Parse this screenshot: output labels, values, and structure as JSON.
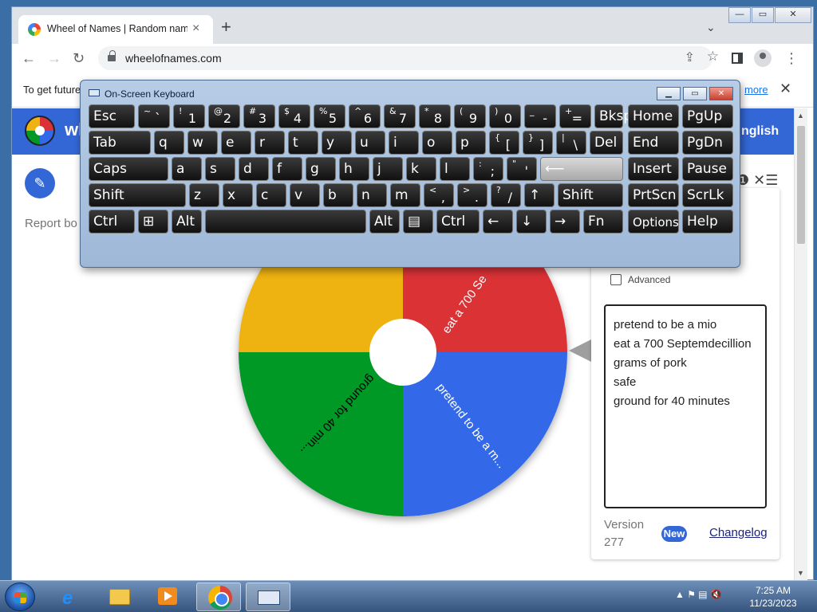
{
  "browser": {
    "tab_title": "Wheel of Names | Random name",
    "tab_close": "×",
    "new_tab": "+",
    "tab_menu": "⌄",
    "url": "wheelofnames.com",
    "back": "←",
    "forward": "→",
    "reload": "↻",
    "share": "⇪",
    "star": "☆",
    "menu": "⋮",
    "win_min": "—",
    "win_max": "▭",
    "win_close": "✕"
  },
  "infobar": {
    "text": "To get future",
    "link": "more",
    "close": "✕"
  },
  "app": {
    "title": "wh",
    "language": "nglish",
    "edit_icon": "✎",
    "report": "Report bo",
    "side_icons": "❶ ✕☰"
  },
  "wheel": {
    "slices": [
      {
        "label": "eat a 700 Se",
        "color": "#db3236"
      },
      {
        "label": "pretend to be a m...",
        "color": "#3369e8"
      },
      {
        "label": "ground for 40 min...",
        "color": "#009925"
      },
      {
        "label": "",
        "color": "#eeb211"
      }
    ]
  },
  "card": {
    "advanced_label": "Advanced",
    "names": [
      "pretend to be a mio",
      "eat a 700 Septemdecillion",
      "grams of pork",
      "safe",
      "ground for 40 minutes"
    ],
    "version_label": "Version",
    "version_number": "277",
    "new_badge": "New",
    "changelog": "Changelog"
  },
  "osk": {
    "title": "On-Screen Keyboard",
    "min": "▁",
    "max": "▭",
    "close": "✕",
    "rows": [
      [
        {
          "main": "Esc"
        },
        {
          "sym": "~",
          "chr": "`"
        },
        {
          "sym": "!",
          "chr": "1"
        },
        {
          "sym": "@",
          "chr": "2"
        },
        {
          "sym": "#",
          "chr": "3"
        },
        {
          "sym": "$",
          "chr": "4"
        },
        {
          "sym": "%",
          "chr": "5"
        },
        {
          "sym": "^",
          "chr": "6"
        },
        {
          "sym": "&",
          "chr": "7"
        },
        {
          "sym": "*",
          "chr": "8"
        },
        {
          "sym": "(",
          "chr": "9"
        },
        {
          "sym": ")",
          "chr": "0"
        },
        {
          "sym": "_",
          "chr": "-"
        },
        {
          "sym": "+",
          "chr": "="
        },
        {
          "main": "Bksp"
        },
        {
          "main": "Home"
        },
        {
          "main": "PgUp"
        }
      ],
      [
        {
          "main": "Tab"
        },
        {
          "main": "q"
        },
        {
          "main": "w"
        },
        {
          "main": "e"
        },
        {
          "main": "r"
        },
        {
          "main": "t"
        },
        {
          "main": "y"
        },
        {
          "main": "u"
        },
        {
          "main": "i"
        },
        {
          "main": "o"
        },
        {
          "main": "p"
        },
        {
          "sym": "{",
          "chr": "["
        },
        {
          "sym": "}",
          "chr": "]"
        },
        {
          "sym": "|",
          "chr": "\\"
        },
        {
          "main": "Del"
        },
        {
          "main": "End"
        },
        {
          "main": "PgDn"
        }
      ],
      [
        {
          "main": "Caps"
        },
        {
          "main": "a"
        },
        {
          "main": "s"
        },
        {
          "main": "d"
        },
        {
          "main": "f"
        },
        {
          "main": "g"
        },
        {
          "main": "h"
        },
        {
          "main": "j"
        },
        {
          "main": "k"
        },
        {
          "main": "l"
        },
        {
          "sym": ":",
          "chr": ";"
        },
        {
          "sym": "\"",
          "chr": "'"
        },
        {
          "main": "⟵"
        },
        {
          "main": "Insert"
        },
        {
          "main": "Pause"
        }
      ],
      [
        {
          "main": "Shift"
        },
        {
          "main": "z"
        },
        {
          "main": "x"
        },
        {
          "main": "c"
        },
        {
          "main": "v"
        },
        {
          "main": "b"
        },
        {
          "main": "n"
        },
        {
          "main": "m"
        },
        {
          "sym": "<",
          "chr": ","
        },
        {
          "sym": ">",
          "chr": "."
        },
        {
          "sym": "?",
          "chr": "/"
        },
        {
          "main": "↑"
        },
        {
          "main": "Shift"
        },
        {
          "main": "PrtScn"
        },
        {
          "main": "ScrLk"
        }
      ],
      [
        {
          "main": "Ctrl"
        },
        {
          "main": "⊞"
        },
        {
          "main": "Alt"
        },
        {
          "main": ""
        },
        {
          "main": "Alt"
        },
        {
          "main": "▤"
        },
        {
          "main": "Ctrl"
        },
        {
          "main": "←"
        },
        {
          "main": "↓"
        },
        {
          "main": "→"
        },
        {
          "main": "Fn"
        },
        {
          "main": "Options"
        },
        {
          "main": "Help"
        }
      ]
    ]
  },
  "taskbar": {
    "tray_icons": "▲ ⚑ ▤ 🔇",
    "time": "7:25 AM",
    "date": "11/23/2023"
  }
}
